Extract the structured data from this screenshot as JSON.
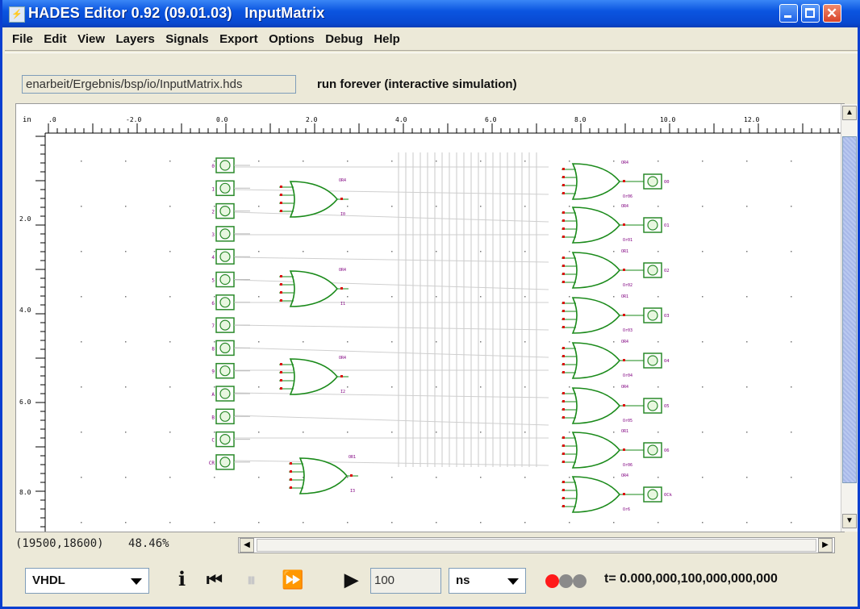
{
  "window": {
    "title": "HADES Editor 0.92 (09.01.03)   InputMatrix",
    "app_icon": "hades-app-icon",
    "controls": [
      "minimize-icon",
      "maximize-icon",
      "close-icon"
    ]
  },
  "menu": [
    "File",
    "Edit",
    "View",
    "Layers",
    "Signals",
    "Export",
    "Options",
    "Debug",
    "Help"
  ],
  "toolbar": {
    "path": "enarbeit/Ergebnis/bsp/io/InputMatrix.hds",
    "run_mode": "run forever (interactive simulation)"
  },
  "ruler": {
    "unit": "in",
    "h_ticks": [
      ".0",
      "-2.0",
      "0.0",
      "2.0",
      "4.0",
      "6.0",
      "8.0",
      "10.0",
      "12.0"
    ],
    "v_ticks": [
      "2.0",
      "4.0",
      "6.0",
      "8.0"
    ]
  },
  "circuit": {
    "inputs": [
      "0",
      "1",
      "2",
      "3",
      "4",
      "5",
      "6",
      "7",
      "8",
      "9",
      "A",
      "B",
      "C",
      "CR"
    ],
    "left_gates": [
      {
        "type": "OR4",
        "name": "I0"
      },
      {
        "type": "OR4",
        "name": "I1"
      },
      {
        "type": "OR4",
        "name": "I2"
      },
      {
        "type": "OR1",
        "name": "I3"
      }
    ],
    "right_gates": [
      {
        "type": "OR4",
        "name": "Or06"
      },
      {
        "type": "OR4",
        "name": "Or01"
      },
      {
        "type": "OR1",
        "name": "Or02"
      },
      {
        "type": "OR1",
        "name": "Or03"
      },
      {
        "type": "OR4",
        "name": "Or04"
      },
      {
        "type": "OR4",
        "name": "Or05"
      },
      {
        "type": "OR1",
        "name": "Or06"
      },
      {
        "type": "OR4",
        "name": "Or6"
      }
    ],
    "outputs": [
      "O0",
      "O1",
      "O2",
      "O3",
      "O4",
      "O5",
      "O6",
      "OCk"
    ]
  },
  "status": {
    "coords": "(19500,18600)",
    "zoom": "48.46%"
  },
  "bottom": {
    "language": "VHDL",
    "info_icon": "info-icon",
    "rewind_icon": "rewind-icon",
    "pause_icon": "pause-icon",
    "fastforward_icon": "fast-forward-icon",
    "play_icon": "play-icon",
    "step_value": "100",
    "time_unit": "ns",
    "time_display": "t= 0.000,000,100,000,000,000",
    "leds": [
      "#ff1a1a",
      "#8a8a8a",
      "#8a8a8a"
    ]
  }
}
